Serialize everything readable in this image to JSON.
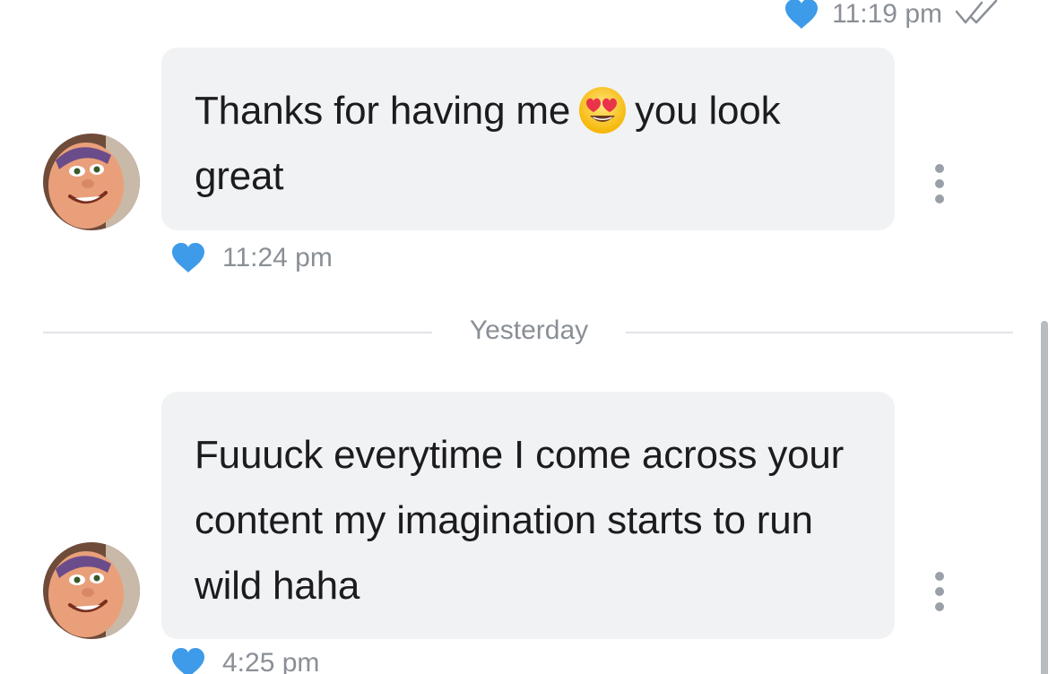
{
  "top_message": {
    "time": "11:19 pm",
    "liked": true,
    "status_icon": "double-check-icon"
  },
  "messages": [
    {
      "text_before_emoji": "Thanks for having me",
      "emoji": "heart-eyes-emoji",
      "text_after_emoji": "you look great",
      "time": "11:24 pm",
      "liked": true
    },
    {
      "text": "Fuuuck everytime I come across your content my imagination starts to run wild haha",
      "time": "4:25 pm",
      "liked": true
    }
  ],
  "divider": {
    "label": "Yesterday"
  },
  "colors": {
    "heart": "#3d9be9",
    "bubble": "#f1f2f4",
    "meta_text": "#8a8f96"
  }
}
